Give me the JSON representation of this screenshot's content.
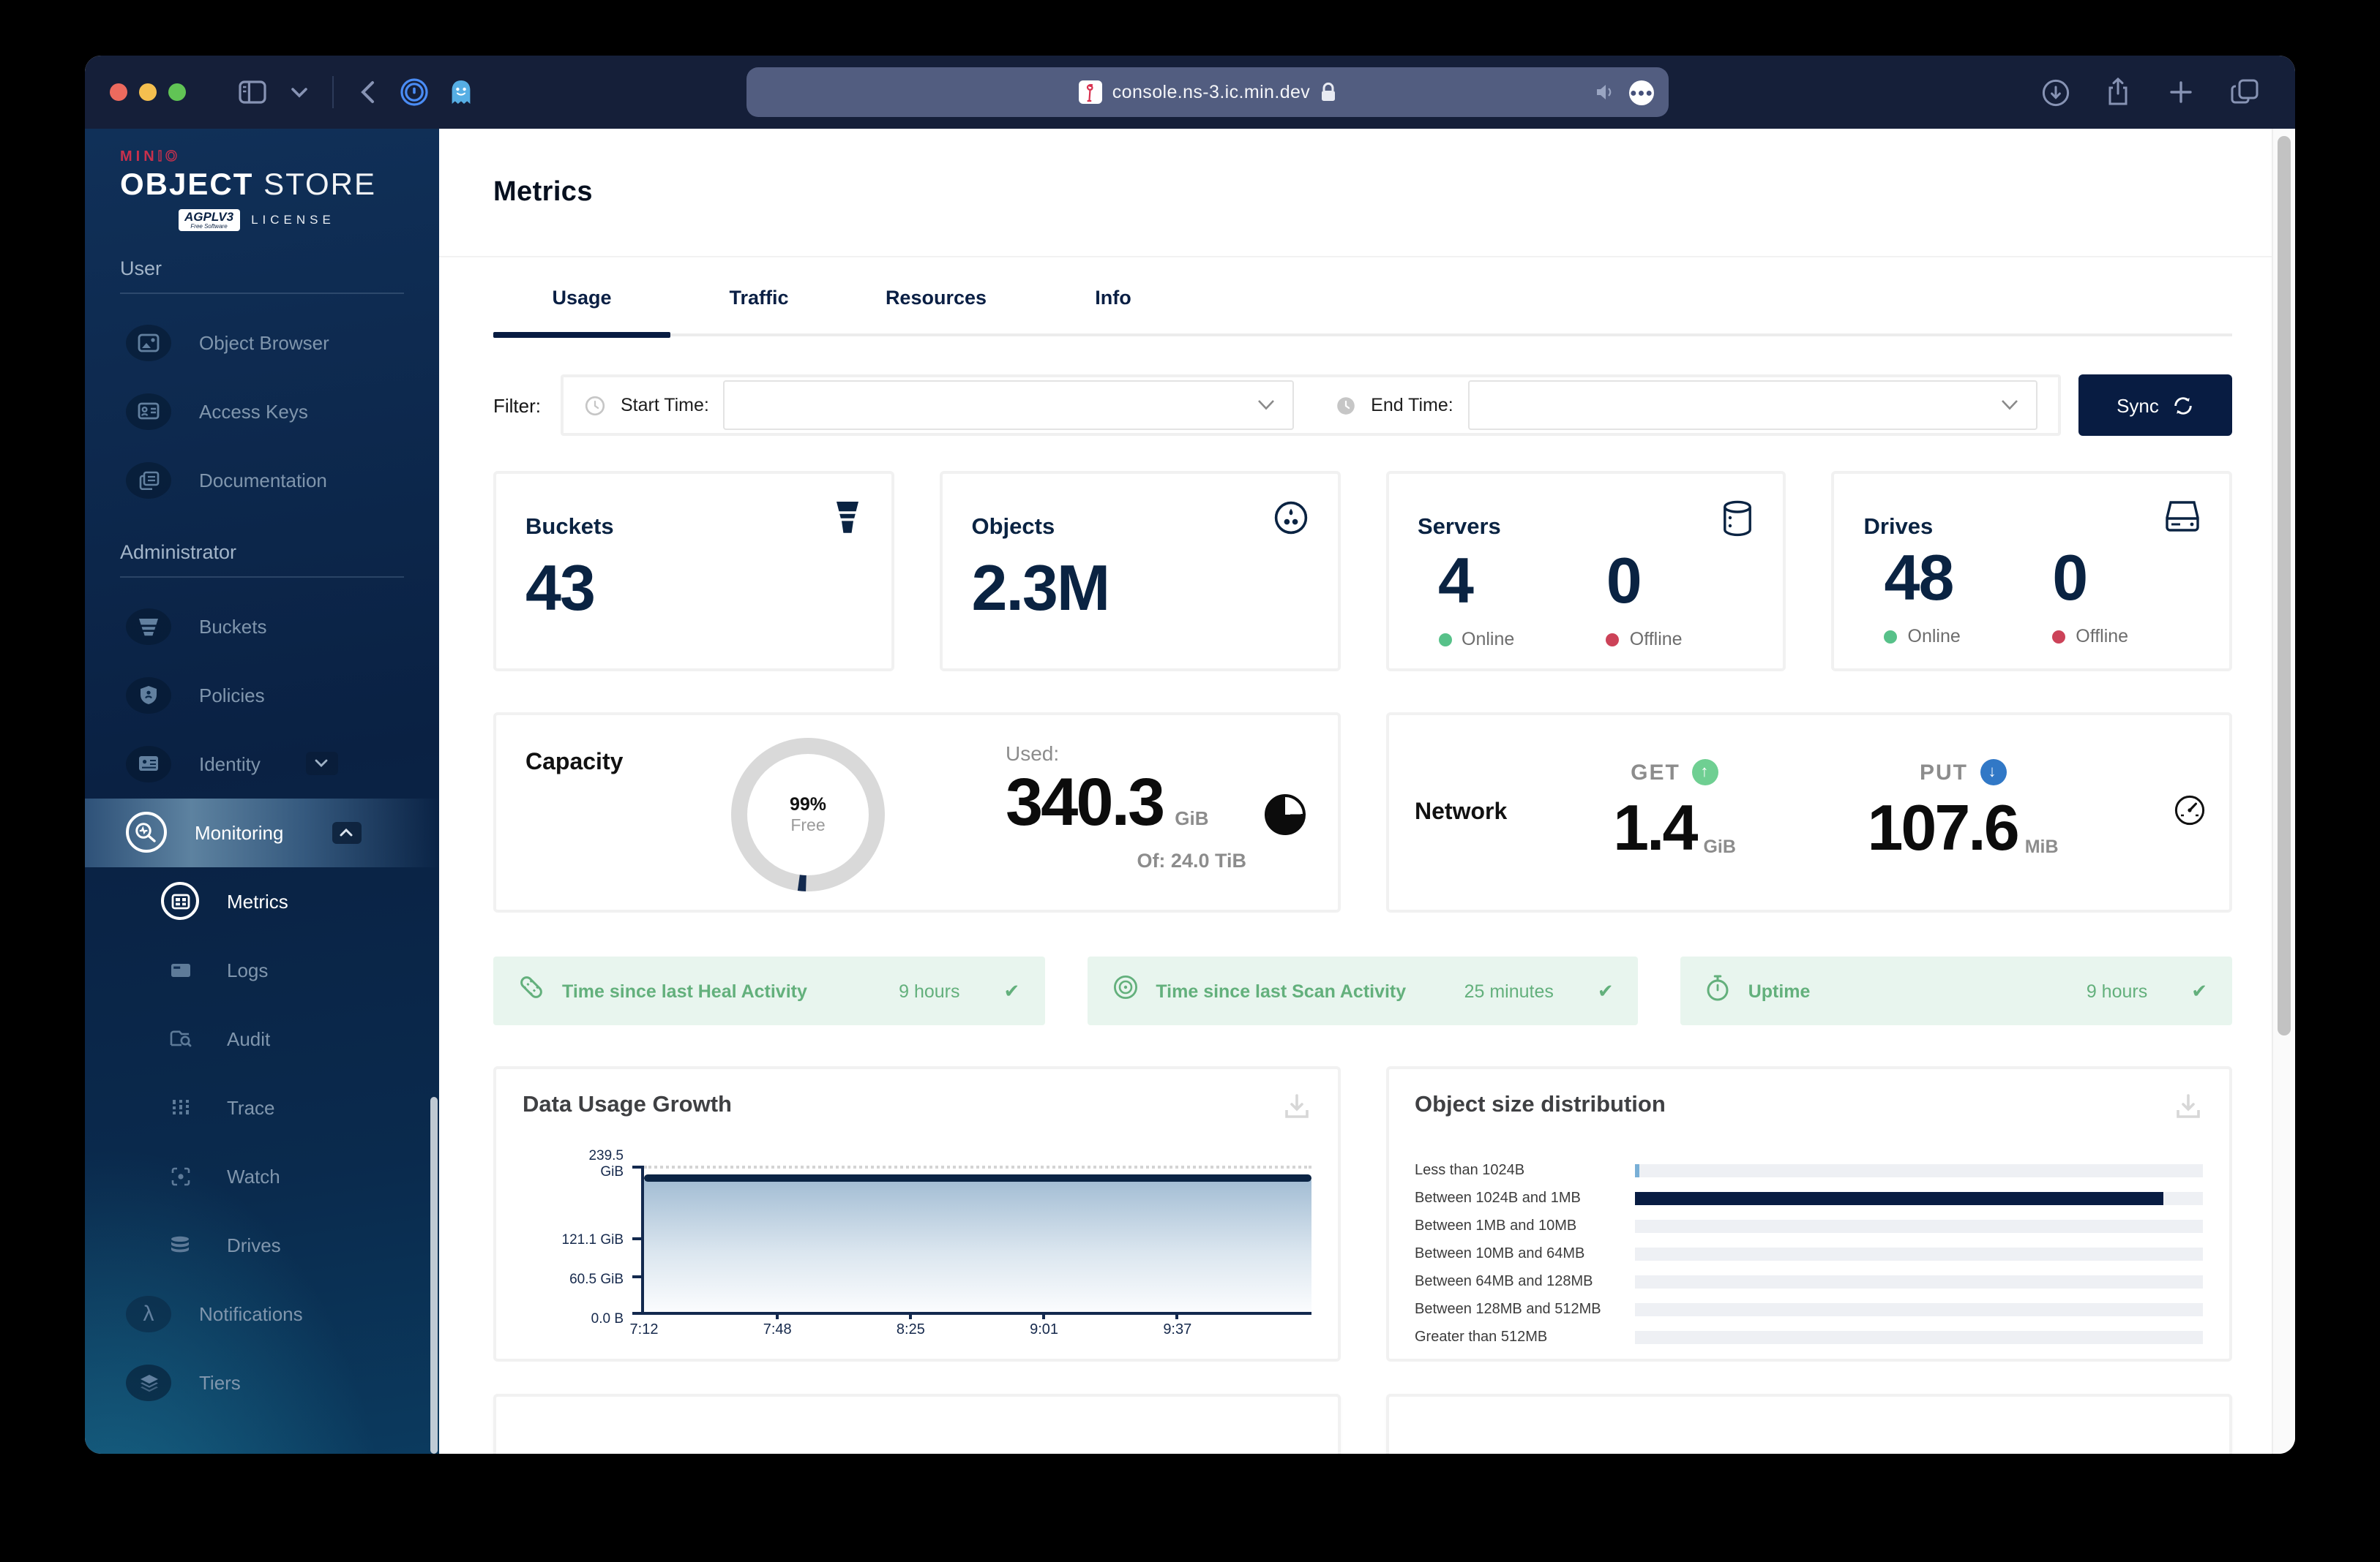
{
  "browser": {
    "url": "console.ns-3.ic.min.dev"
  },
  "sidebar": {
    "logo": {
      "min": "MIN",
      "io": "IO",
      "object": "OBJECT",
      "store": "STORE",
      "badge": "AGPLV3",
      "badge_sub": "Free Software",
      "license": "LICENSE"
    },
    "user_section": "User",
    "admin_section": "Administrator",
    "items": {
      "object_browser": "Object Browser",
      "access_keys": "Access Keys",
      "documentation": "Documentation",
      "buckets": "Buckets",
      "policies": "Policies",
      "identity": "Identity",
      "monitoring": "Monitoring",
      "metrics": "Metrics",
      "logs": "Logs",
      "audit": "Audit",
      "trace": "Trace",
      "watch": "Watch",
      "drives": "Drives",
      "notifications": "Notifications",
      "tiers": "Tiers"
    }
  },
  "header": {
    "title": "Metrics"
  },
  "tabs": [
    {
      "label": "Usage",
      "active": true
    },
    {
      "label": "Traffic",
      "active": false
    },
    {
      "label": "Resources",
      "active": false
    },
    {
      "label": "Info",
      "active": false
    }
  ],
  "filter": {
    "label": "Filter:",
    "start_label": "Start Time:",
    "end_label": "End Time:",
    "sync_label": "Sync"
  },
  "stats": [
    {
      "title": "Buckets",
      "value": "43",
      "icon": "bucket"
    },
    {
      "title": "Objects",
      "value": "2.3M",
      "icon": "objects"
    },
    {
      "title": "Servers",
      "icon": "server-cylinder",
      "online": "4",
      "online_label": "Online",
      "offline": "0",
      "offline_label": "Offline"
    },
    {
      "title": "Drives",
      "icon": "drive",
      "online": "48",
      "online_label": "Online",
      "offline": "0",
      "offline_label": "Offline"
    }
  ],
  "capacity": {
    "title": "Capacity",
    "gauge_pct": "99%",
    "gauge_label": "Free",
    "used_pct_of_total": 1.4,
    "used_label": "Used:",
    "used_value": "340.3",
    "used_unit": "GiB",
    "total_label": "Of: 24.0 TiB"
  },
  "network": {
    "title": "Network",
    "get_label": "GET",
    "get_value": "1.4",
    "get_unit": "GiB",
    "put_label": "PUT",
    "put_value": "107.6",
    "put_unit": "MiB"
  },
  "status_bars": [
    {
      "label": "Time since last Heal Activity",
      "value": "9 hours",
      "icon": "bandage"
    },
    {
      "label": "Time since last Scan Activity",
      "value": "25 minutes",
      "icon": "scan-target"
    },
    {
      "label": "Uptime",
      "value": "9 hours",
      "icon": "stopwatch"
    }
  ],
  "chart_data": [
    {
      "type": "area",
      "title": "Data Usage Growth",
      "x_ticks": [
        "7:12",
        "7:48",
        "8:25",
        "9:01",
        "9:37"
      ],
      "x_tick_pct": [
        0,
        20,
        40,
        60,
        80
      ],
      "y_ticks": [
        [
          "239.5",
          "GiB"
        ],
        [
          "121.1 GiB"
        ],
        [
          "60.5 GiB"
        ],
        [
          "0.0 B"
        ]
      ],
      "y_tick_values": [
        239.5,
        121.1,
        60.5,
        0
      ],
      "ylim": [
        0,
        239.5
      ],
      "unit": "GiB",
      "grid": "dotted-horizontal",
      "series": [
        {
          "name": "Data Usage",
          "values": [
            220,
            220,
            220,
            220,
            220,
            220
          ],
          "color": "#0B2444"
        }
      ]
    },
    {
      "type": "bar",
      "orientation": "horizontal",
      "title": "Object size distribution",
      "categories": [
        "Less than 1024B",
        "Between 1024B and 1MB",
        "Between 1MB and 10MB",
        "Between 10MB and 64MB",
        "Between 64MB and 128MB",
        "Between 128MB and 512MB",
        "Greater than 512MB"
      ],
      "values_pct": [
        0.8,
        93,
        0,
        0,
        0,
        0,
        0
      ],
      "track_color": "#eef0f4",
      "bar_color": "#081C42",
      "sliver_color": "#79AFD6"
    }
  ]
}
